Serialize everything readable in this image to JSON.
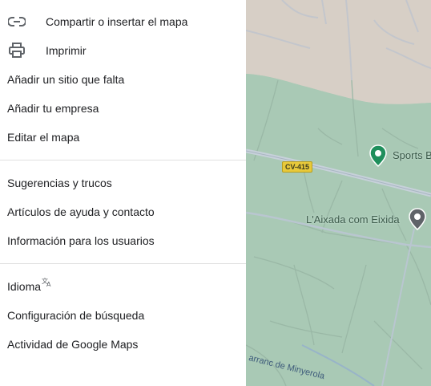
{
  "menu": {
    "share_label": "Compartir o insertar el mapa",
    "print_label": "Imprimir",
    "add_place_label": "Añadir un sitio que falta",
    "add_business_label": "Añadir tu empresa",
    "edit_map_label": "Editar el mapa",
    "tips_label": "Sugerencias y trucos",
    "help_label": "Artículos de ayuda y contacto",
    "users_info_label": "Información para los usuarios",
    "language_label": "Idioma",
    "search_settings_label": "Configuración de búsqueda",
    "activity_label": "Actividad de Google Maps"
  },
  "map": {
    "road_badge": "CV-415",
    "poi_sports": "Sports B",
    "poi_aixada": "L'Aixada com Eixida",
    "street_name": "arranc de Minyerola",
    "colors": {
      "urban": "#ddd4cc",
      "green": "#a8c8b4",
      "road": "#c9d3dc",
      "pin_green": "#1e8e5a",
      "pin_gray": "#5f6368"
    }
  }
}
